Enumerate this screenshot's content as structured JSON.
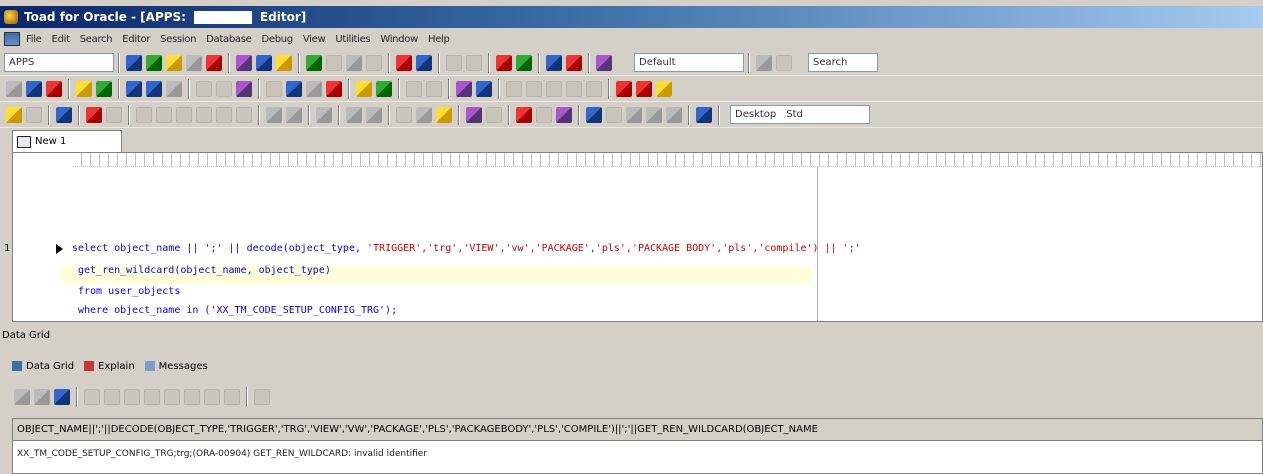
{
  "window": {
    "title_prefix": "Toad for Oracle - [APPS:",
    "title_suffix": "Editor]"
  },
  "menubar": {
    "items": [
      "File",
      "Edit",
      "Search",
      "Editor",
      "Session",
      "Database",
      "Debug",
      "View",
      "Utilities",
      "Window",
      "Help"
    ]
  },
  "toolbar": {
    "row1_combo": "APPS",
    "layout_combo": "Default",
    "search_combo": "Search",
    "desktop_combo_label": "Desktop",
    "desktop_combo_value": "Std"
  },
  "editor": {
    "tab_label": "New 1",
    "line_number": "1",
    "code": {
      "line1_a": "select object_name || ';' || decode(object_type,",
      "line1_b": "'TRIGGER','trg','VIEW','vw','PACKAGE','pls','PACKAGE BODY','pls','compile') || ';'",
      "line2": "get_ren_wildcard(object_name, object_type)",
      "line3": "from user_objects",
      "line4": "where object_name in ('XX_TM_CODE_SETUP_CONFIG_TRG');"
    }
  },
  "bottom": {
    "section_label": "Data Grid",
    "tabs": [
      "Data Grid",
      "Explain",
      "Messages"
    ],
    "grid": {
      "header": "OBJECT_NAME||';'||DECODE(OBJECT_TYPE,'TRIGGER','TRG','VIEW','VW','PACKAGE','PLS','PACKAGEBODY','PLS','COMPILE')||';'||GET_REN_WILDCARD(OBJECT_NAME",
      "row1": "XX_TM_CODE_SETUP_CONFIG_TRG;trg;(ORA-00904) GET_REN_WILDCARD: invalid identifier"
    }
  }
}
